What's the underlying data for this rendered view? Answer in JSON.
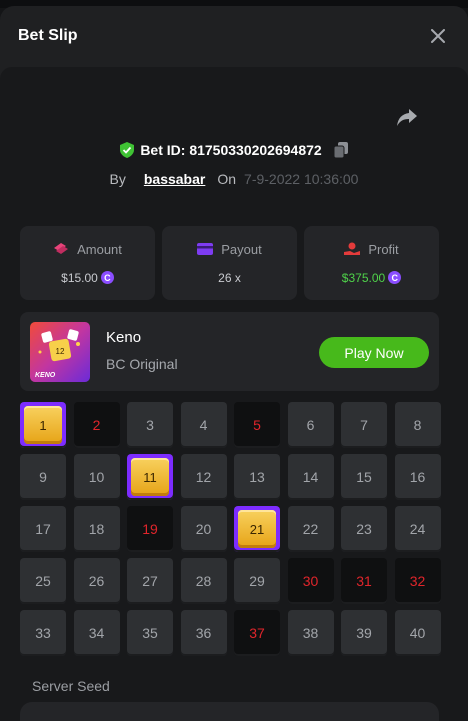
{
  "modal": {
    "title": "Bet Slip"
  },
  "bet": {
    "id_text": "Bet ID: 81750330202694872",
    "by_label": "By",
    "user": "bassabar",
    "on_label": "On",
    "date": "7-9-2022 10:36:00"
  },
  "stats": {
    "amount": {
      "label": "Amount",
      "value": "$15.00",
      "icon": "money-icon"
    },
    "payout": {
      "label": "Payout",
      "value": "26 x",
      "icon": "card-icon"
    },
    "profit": {
      "label": "Profit",
      "value": "$375.00",
      "icon": "profit-icon"
    },
    "coin_symbol": "C"
  },
  "game": {
    "name": "Keno",
    "subtitle": "BC Original",
    "play_label": "Play Now",
    "thumb_text": "KENO",
    "thumb_ball": "12"
  },
  "grid": {
    "cells": [
      {
        "n": "1",
        "s": "hit"
      },
      {
        "n": "2",
        "s": "miss"
      },
      {
        "n": "3",
        "s": "plain"
      },
      {
        "n": "4",
        "s": "plain"
      },
      {
        "n": "5",
        "s": "miss"
      },
      {
        "n": "6",
        "s": "plain"
      },
      {
        "n": "7",
        "s": "plain"
      },
      {
        "n": "8",
        "s": "plain"
      },
      {
        "n": "9",
        "s": "plain"
      },
      {
        "n": "10",
        "s": "plain"
      },
      {
        "n": "11",
        "s": "hit"
      },
      {
        "n": "12",
        "s": "plain"
      },
      {
        "n": "13",
        "s": "plain"
      },
      {
        "n": "14",
        "s": "plain"
      },
      {
        "n": "15",
        "s": "plain"
      },
      {
        "n": "16",
        "s": "plain"
      },
      {
        "n": "17",
        "s": "plain"
      },
      {
        "n": "18",
        "s": "plain"
      },
      {
        "n": "19",
        "s": "miss"
      },
      {
        "n": "20",
        "s": "plain"
      },
      {
        "n": "21",
        "s": "hit"
      },
      {
        "n": "22",
        "s": "plain"
      },
      {
        "n": "23",
        "s": "plain"
      },
      {
        "n": "24",
        "s": "plain"
      },
      {
        "n": "25",
        "s": "plain"
      },
      {
        "n": "26",
        "s": "plain"
      },
      {
        "n": "27",
        "s": "plain"
      },
      {
        "n": "28",
        "s": "plain"
      },
      {
        "n": "29",
        "s": "plain"
      },
      {
        "n": "30",
        "s": "miss"
      },
      {
        "n": "31",
        "s": "miss"
      },
      {
        "n": "32",
        "s": "miss"
      },
      {
        "n": "33",
        "s": "plain"
      },
      {
        "n": "34",
        "s": "plain"
      },
      {
        "n": "35",
        "s": "plain"
      },
      {
        "n": "36",
        "s": "plain"
      },
      {
        "n": "37",
        "s": "miss"
      },
      {
        "n": "38",
        "s": "plain"
      },
      {
        "n": "39",
        "s": "plain"
      },
      {
        "n": "40",
        "s": "plain"
      }
    ]
  },
  "seed": {
    "label": "Server Seed"
  },
  "colors": {
    "accent": "#7d2cff",
    "play": "#47b91b",
    "profit": "#4fd34a",
    "miss": "#e0252b"
  }
}
